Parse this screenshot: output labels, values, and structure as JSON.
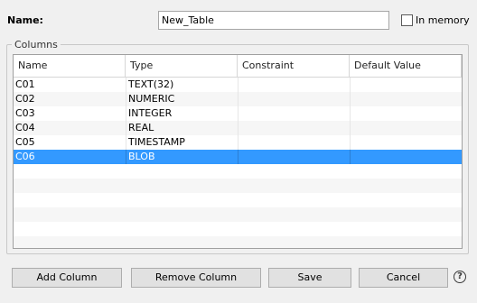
{
  "form": {
    "name_label": "Name:",
    "name_value": "New_Table",
    "in_memory_label": "In memory",
    "in_memory_checked": false
  },
  "columns_group": {
    "title": "Columns",
    "headers": [
      "Name",
      "Type",
      "Constraint",
      "Default Value"
    ],
    "rows": [
      {
        "name": "C01",
        "type": "TEXT(32)",
        "constraint": "",
        "default": ""
      },
      {
        "name": "C02",
        "type": "NUMERIC",
        "constraint": "",
        "default": ""
      },
      {
        "name": "C03",
        "type": "INTEGER",
        "constraint": "",
        "default": ""
      },
      {
        "name": "C04",
        "type": "REAL",
        "constraint": "",
        "default": ""
      },
      {
        "name": "C05",
        "type": "TIMESTAMP",
        "constraint": "",
        "default": ""
      },
      {
        "name": "C06",
        "type": "BLOB",
        "constraint": "",
        "default": ""
      }
    ],
    "selected_row": 5,
    "selection_color": "#3399ff"
  },
  "buttons": {
    "add_column": "Add Column",
    "remove_column": "Remove Column",
    "save": "Save",
    "cancel": "Cancel",
    "help_icon": "help-icon"
  }
}
